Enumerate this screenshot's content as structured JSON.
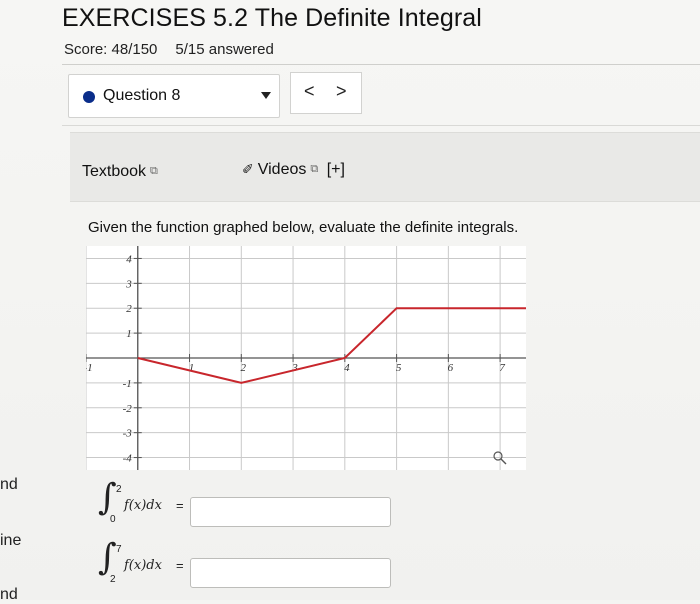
{
  "header": {
    "title": "EXERCISES 5.2 The Definite Integral",
    "score": "Score: 48/150",
    "answered": "5/15 answered"
  },
  "question_nav": {
    "label": "Question 8",
    "prev": "<",
    "next": ">"
  },
  "resources": {
    "textbook": "Textbook",
    "videos": "Videos",
    "expand": "[+]"
  },
  "prompt": "Given the function graphed below, evaluate the definite integrals.",
  "left_edge": [
    "nd",
    "ine",
    "nd"
  ],
  "chart_data": {
    "type": "line",
    "x_ticks": [
      "-1",
      "1",
      "2",
      "3",
      "4",
      "5",
      "6",
      "7"
    ],
    "y_ticks": [
      "4",
      "3",
      "2",
      "1",
      "-1",
      "-2",
      "-3",
      "-4"
    ],
    "xlim": [
      -1,
      7.5
    ],
    "ylim": [
      -4.5,
      4.5
    ],
    "grid": true,
    "series": [
      {
        "points": [
          [
            0,
            0
          ],
          [
            2,
            -1
          ],
          [
            4,
            0
          ],
          [
            5,
            2
          ],
          [
            7.5,
            2
          ]
        ],
        "color": "#c8262c"
      }
    ]
  },
  "integrals": [
    {
      "lower": "0",
      "upper": "2",
      "expr": "f(x)dx",
      "eq": "=",
      "value": ""
    },
    {
      "lower": "2",
      "upper": "7",
      "expr": "f(x)dx",
      "eq": "=",
      "value": ""
    }
  ]
}
